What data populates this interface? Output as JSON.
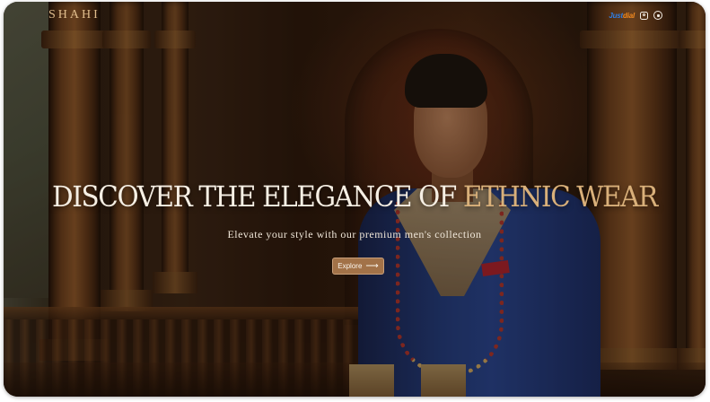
{
  "header": {
    "brand": "SHAHI",
    "social": {
      "justdial_part1": "Just",
      "justdial_part2": "dial",
      "instagram_icon": "instagram-icon",
      "whatsapp_icon": "whatsapp-icon"
    }
  },
  "hero": {
    "headline_main": "DISCOVER THE ELEGANCE OF ",
    "headline_accent": "ETHNIC WEAR",
    "subtitle": "Elevate your style with our premium men's collection",
    "cta_label": "Explore",
    "cta_arrow": "⟶",
    "background_image": "man-in-blue-sherwani-palace-photo"
  },
  "colors": {
    "brand": "#e0bd8c",
    "accent": "#d9b07a",
    "button": "#a27248",
    "justdial_blue": "#2f7fe6",
    "justdial_orange": "#f28a1f"
  }
}
